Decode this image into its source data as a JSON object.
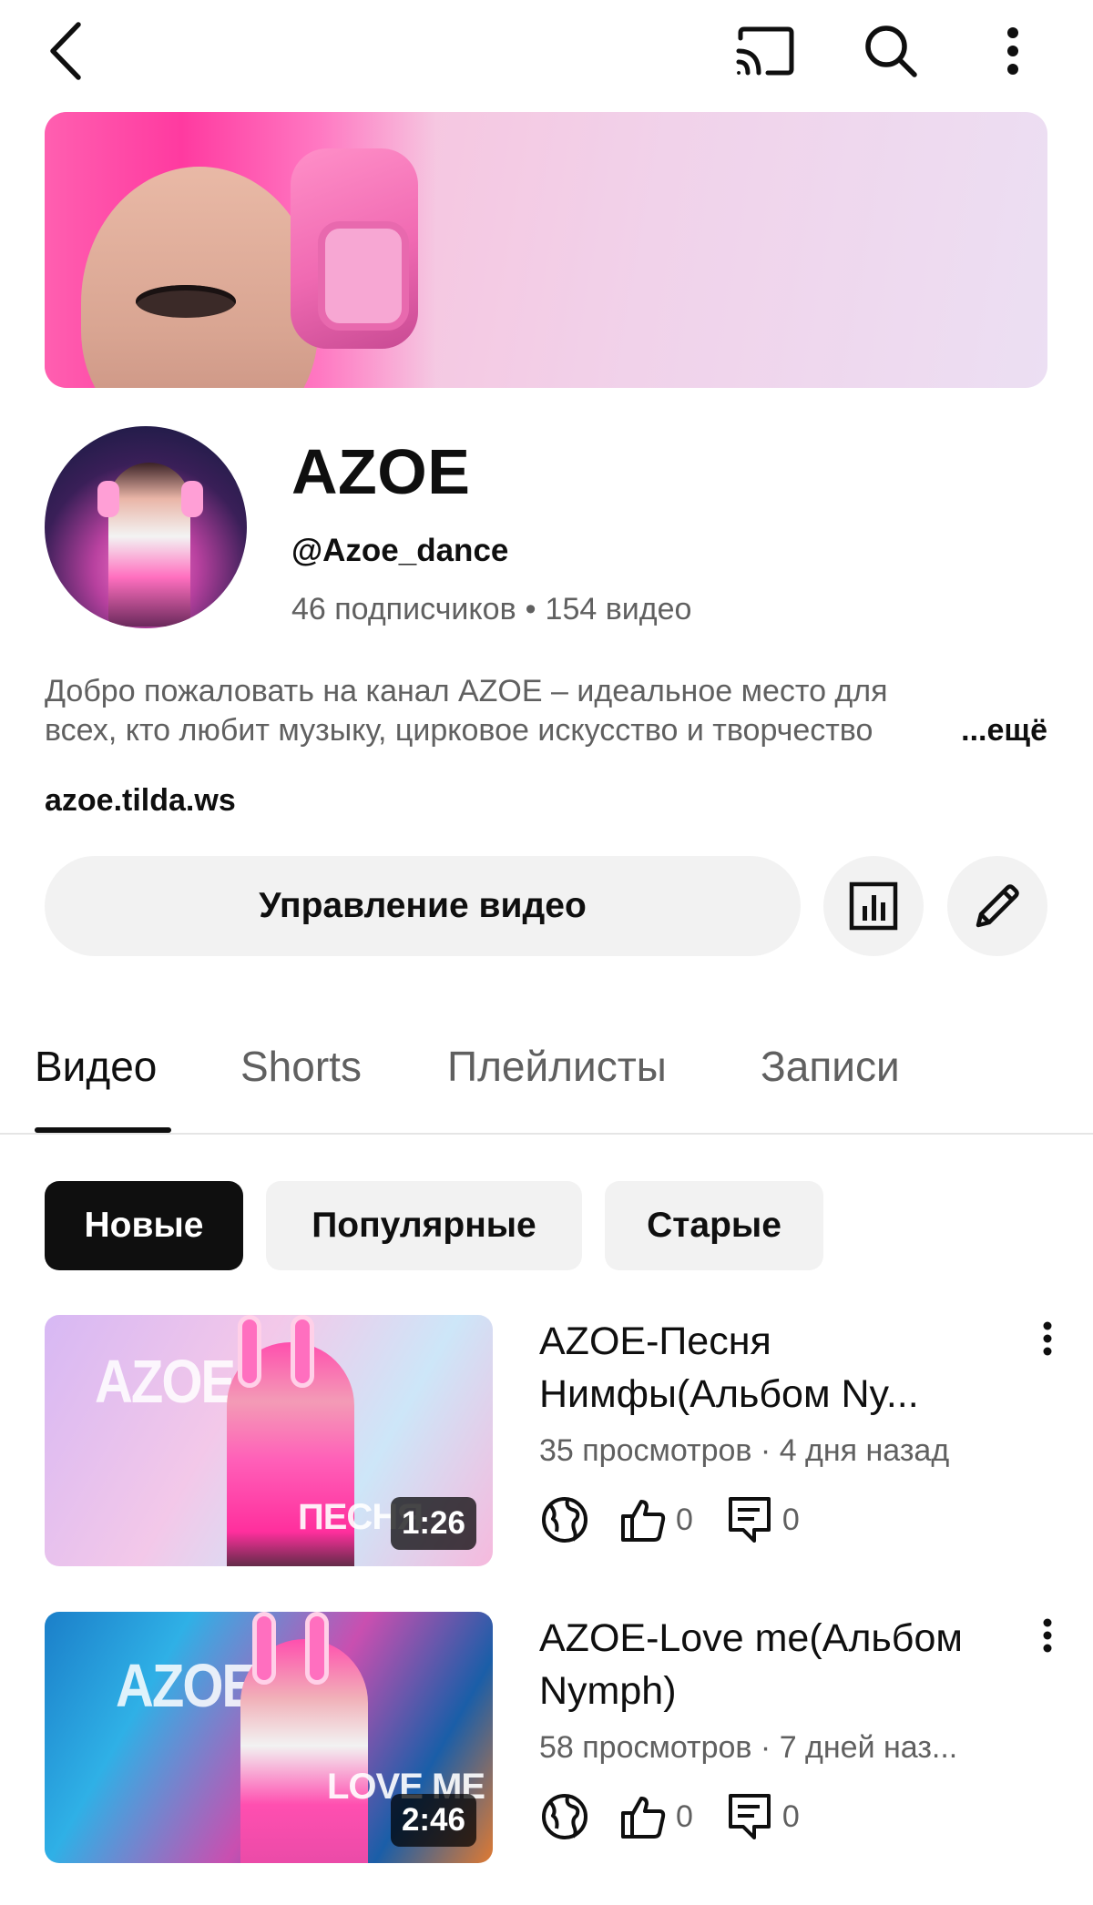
{
  "topbar": {
    "back_icon": "back-arrow-icon",
    "cast_icon": "cast-icon",
    "search_icon": "search-icon",
    "more_icon": "more-vertical-icon"
  },
  "channel": {
    "name": "AZOE",
    "handle": "@Azoe_dance",
    "subscribers": "46 подписчиков",
    "separator": "•",
    "videos_count": "154 видео",
    "description_line1": "Добро пожаловать на канал AZOE – идеальное место для",
    "description_line2": "всех, кто любит музыку, цирковое искусство и творчество",
    "more_label": "...ещё",
    "link": "azoe.tilda.ws"
  },
  "actions": {
    "manage_label": "Управление видео",
    "analytics_icon": "analytics-icon",
    "edit_icon": "edit-pencil-icon"
  },
  "tabs": [
    {
      "label": "Видео",
      "active": true
    },
    {
      "label": "Shorts",
      "active": false
    },
    {
      "label": "Плейлисты",
      "active": false
    },
    {
      "label": "Записи",
      "active": false
    }
  ],
  "chips": [
    {
      "label": "Новые",
      "active": true
    },
    {
      "label": "Популярные",
      "active": false
    },
    {
      "label": "Старые",
      "active": false
    }
  ],
  "videos": [
    {
      "title": "AZOE-Песня Нимфы(Альбом Ny...",
      "thumb_text": "AZOE",
      "thumb_subtext": "ПЕСНЯ",
      "duration": "1:26",
      "meta": "35 просмотров · 4 дня назад",
      "likes": "0",
      "comments": "0"
    },
    {
      "title": "AZOE-Love me(Альбом Nymph)",
      "thumb_text": "AZOE",
      "thumb_subtext": "LOVE ME",
      "duration": "2:46",
      "meta": "58 просмотров · 7 дней наз...",
      "likes": "0",
      "comments": "0"
    }
  ]
}
